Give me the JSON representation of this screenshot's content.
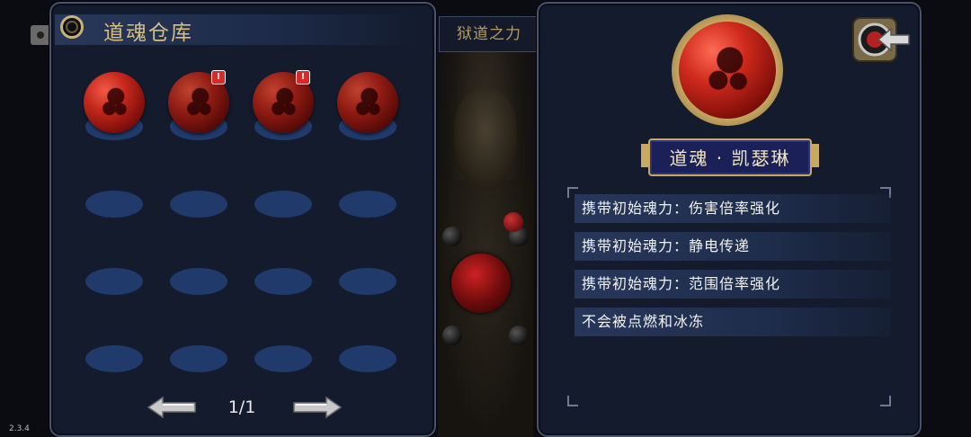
{
  "version": "2.3.4",
  "background_tab": "狱道之力",
  "warehouse": {
    "title": "道魂仓库",
    "slots": [
      {
        "filled": true,
        "badge": ""
      },
      {
        "filled": true,
        "badge": "!"
      },
      {
        "filled": true,
        "badge": "!"
      },
      {
        "filled": true,
        "badge": ""
      },
      {
        "filled": false
      },
      {
        "filled": false
      },
      {
        "filled": false
      },
      {
        "filled": false
      },
      {
        "filled": false
      },
      {
        "filled": false
      },
      {
        "filled": false
      },
      {
        "filled": false
      },
      {
        "filled": false
      },
      {
        "filled": false
      },
      {
        "filled": false
      },
      {
        "filled": false
      }
    ],
    "pager": {
      "text": "1/1"
    }
  },
  "detail": {
    "name": "道魂 · 凯瑟琳",
    "attributes": [
      "携带初始魂力：伤害倍率强化",
      "携带初始魂力：静电传递",
      "携带初始魂力：范围倍率强化",
      "不会被点燃和冰冻"
    ]
  },
  "icons": {
    "title": "ring-icon",
    "prev": "arrow-left-icon",
    "next": "arrow-right-icon",
    "back": "back-arrow-icon"
  },
  "colors": {
    "panel_bg": "#131b2d",
    "title_gold": "#d7be7c",
    "orb_red": "#c4281c",
    "slot_blue": "#203a6c",
    "badge_red": "#d52b2b"
  }
}
